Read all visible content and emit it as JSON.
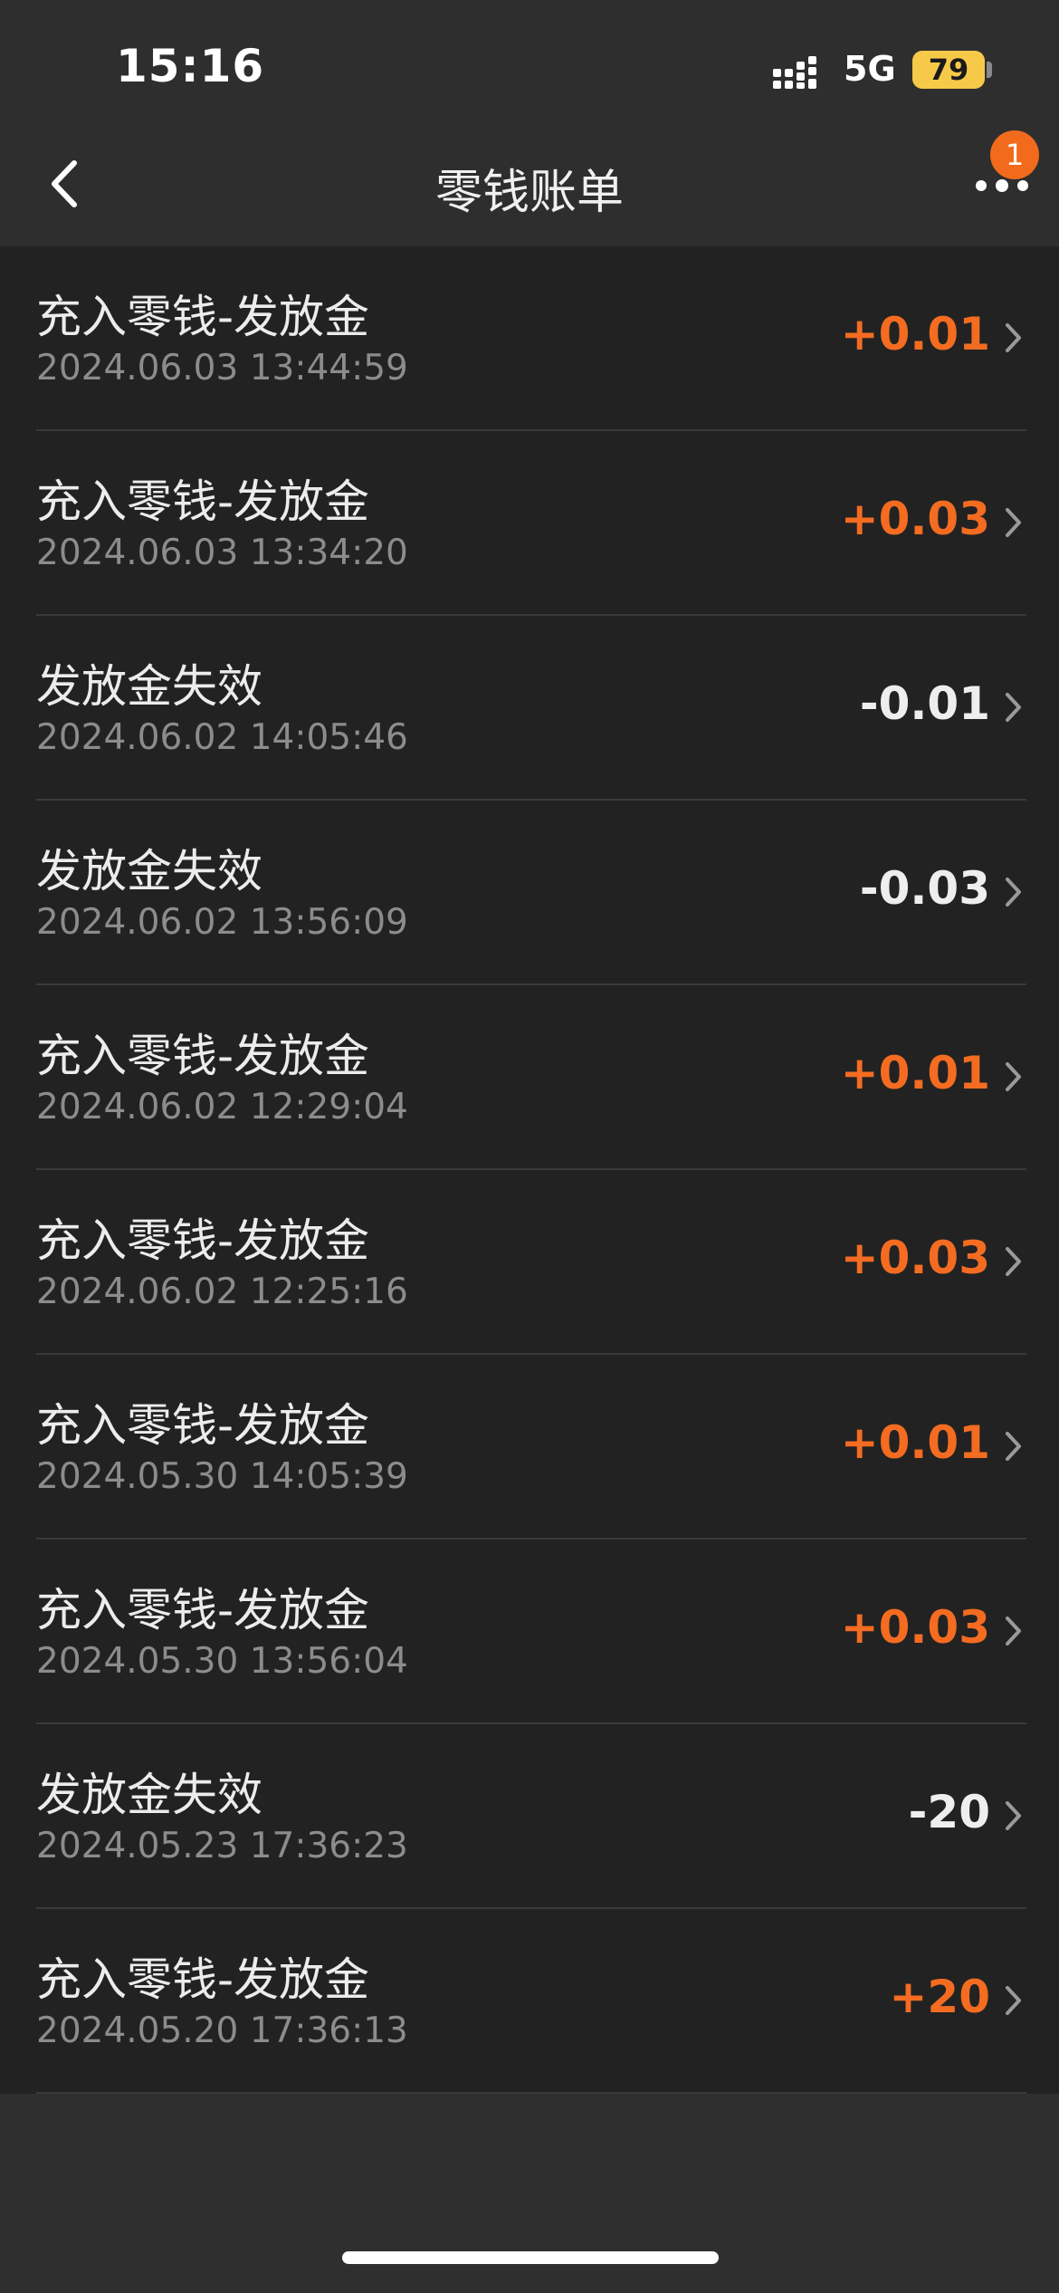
{
  "status_bar": {
    "time": "15:16",
    "network": "5G",
    "battery": "79"
  },
  "nav": {
    "title": "零钱账单",
    "badge_count": "1"
  },
  "colors": {
    "positive": "#f36c21",
    "negative": "#eeeeee",
    "badge": "#f26a1b",
    "battery": "#f7c948"
  },
  "transactions": [
    {
      "title": "充入零钱-发放金",
      "time": "2024.06.03 13:44:59",
      "amount": "+0.01",
      "type": "positive"
    },
    {
      "title": "充入零钱-发放金",
      "time": "2024.06.03 13:34:20",
      "amount": "+0.03",
      "type": "positive"
    },
    {
      "title": "发放金失效",
      "time": "2024.06.02 14:05:46",
      "amount": "-0.01",
      "type": "negative"
    },
    {
      "title": "发放金失效",
      "time": "2024.06.02 13:56:09",
      "amount": "-0.03",
      "type": "negative"
    },
    {
      "title": "充入零钱-发放金",
      "time": "2024.06.02 12:29:04",
      "amount": "+0.01",
      "type": "positive"
    },
    {
      "title": "充入零钱-发放金",
      "time": "2024.06.02 12:25:16",
      "amount": "+0.03",
      "type": "positive"
    },
    {
      "title": "充入零钱-发放金",
      "time": "2024.05.30 14:05:39",
      "amount": "+0.01",
      "type": "positive"
    },
    {
      "title": "充入零钱-发放金",
      "time": "2024.05.30 13:56:04",
      "amount": "+0.03",
      "type": "positive"
    },
    {
      "title": "发放金失效",
      "time": "2024.05.23 17:36:23",
      "amount": "-20",
      "type": "negative"
    },
    {
      "title": "充入零钱-发放金",
      "time": "2024.05.20 17:36:13",
      "amount": "+20",
      "type": "positive"
    }
  ],
  "icons": {
    "back": "chevron-left-icon",
    "more": "more-dots-icon",
    "row": "chevron-right-icon",
    "signal": "signal-bars-icon"
  }
}
